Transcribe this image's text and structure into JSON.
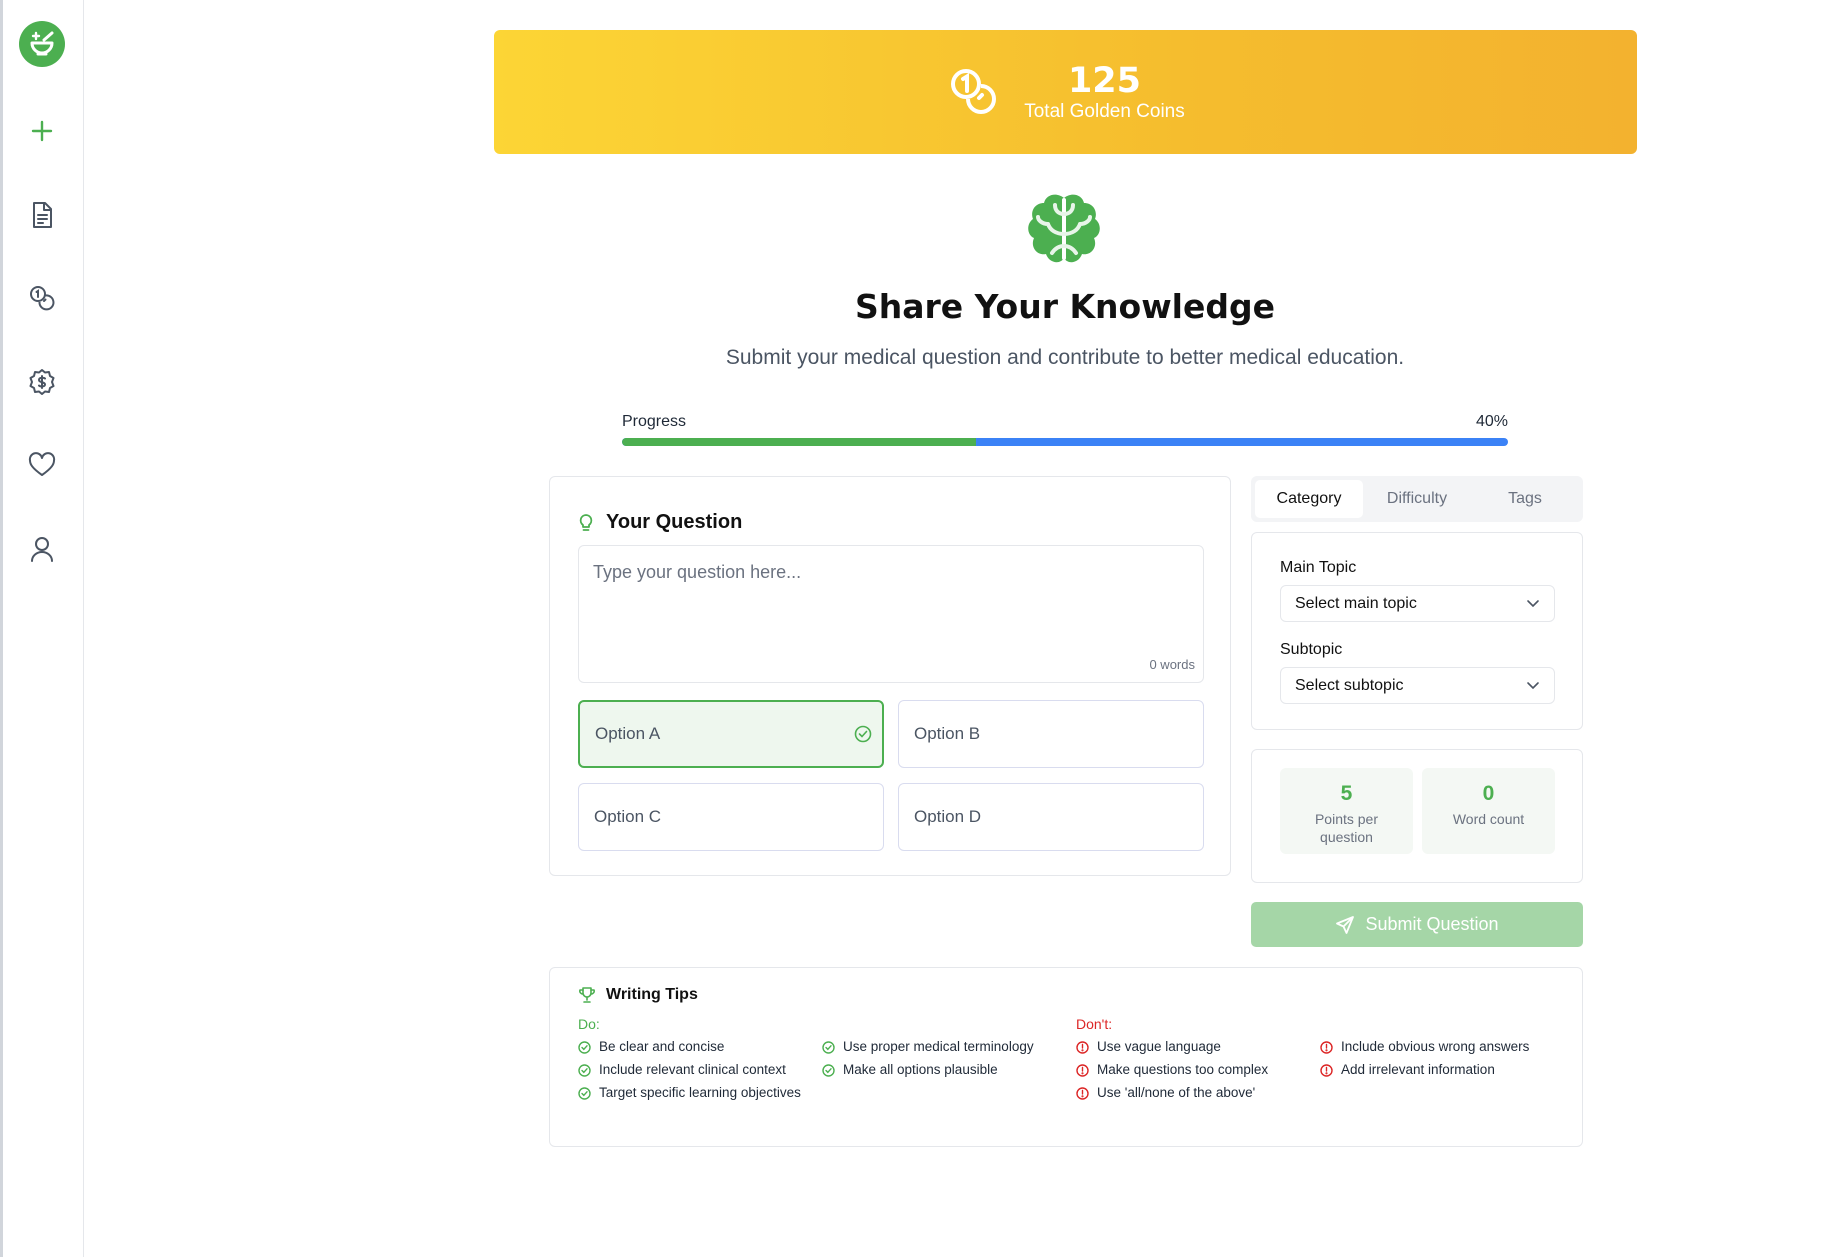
{
  "sidebar": {
    "items": [
      {
        "icon": "plus-icon"
      },
      {
        "icon": "document-icon"
      },
      {
        "icon": "coins-icon"
      },
      {
        "icon": "dollar-badge-icon"
      },
      {
        "icon": "heart-icon"
      },
      {
        "icon": "user-icon"
      }
    ]
  },
  "banner": {
    "coins": "125",
    "label": "Total Golden Coins"
  },
  "header": {
    "title": "Share Your Knowledge",
    "subtitle": "Submit your medical question and contribute to better medical education."
  },
  "progress": {
    "label": "Progress",
    "percent_text": "40%",
    "value": 0.4
  },
  "question": {
    "title": "Your Question",
    "placeholder": "Type your question here...",
    "word_count": "0 words",
    "options": [
      {
        "label": "Option A",
        "selected": true
      },
      {
        "label": "Option B",
        "selected": false
      },
      {
        "label": "Option C",
        "selected": false
      },
      {
        "label": "Option D",
        "selected": false
      }
    ]
  },
  "tabs": [
    "Category",
    "Difficulty",
    "Tags"
  ],
  "topics": {
    "main_label": "Main Topic",
    "main_value": "Select main topic",
    "sub_label": "Subtopic",
    "sub_value": "Select subtopic"
  },
  "stats": {
    "points_value": "5",
    "points_label": "Points per question",
    "words_value": "0",
    "words_label": "Word count"
  },
  "submit_label": "Submit Question",
  "tips": {
    "title": "Writing Tips",
    "do_label": "Do:",
    "dont_label": "Don't:",
    "do_col1": [
      "Be clear and concise",
      "Include relevant clinical context",
      "Target specific learning objectives"
    ],
    "do_col2": [
      "Use proper medical terminology",
      "Make all options plausible"
    ],
    "dont_col1": [
      "Use vague language",
      "Make questions too complex",
      "Use 'all/none of the above'"
    ],
    "dont_col2": [
      "Include obvious wrong answers",
      "Add irrelevant information"
    ]
  },
  "colors": {
    "brand_green": "#4caf50",
    "progress_blue": "#3b82f6",
    "dont_red": "#dc2626",
    "gold": "#f5bd2e"
  }
}
